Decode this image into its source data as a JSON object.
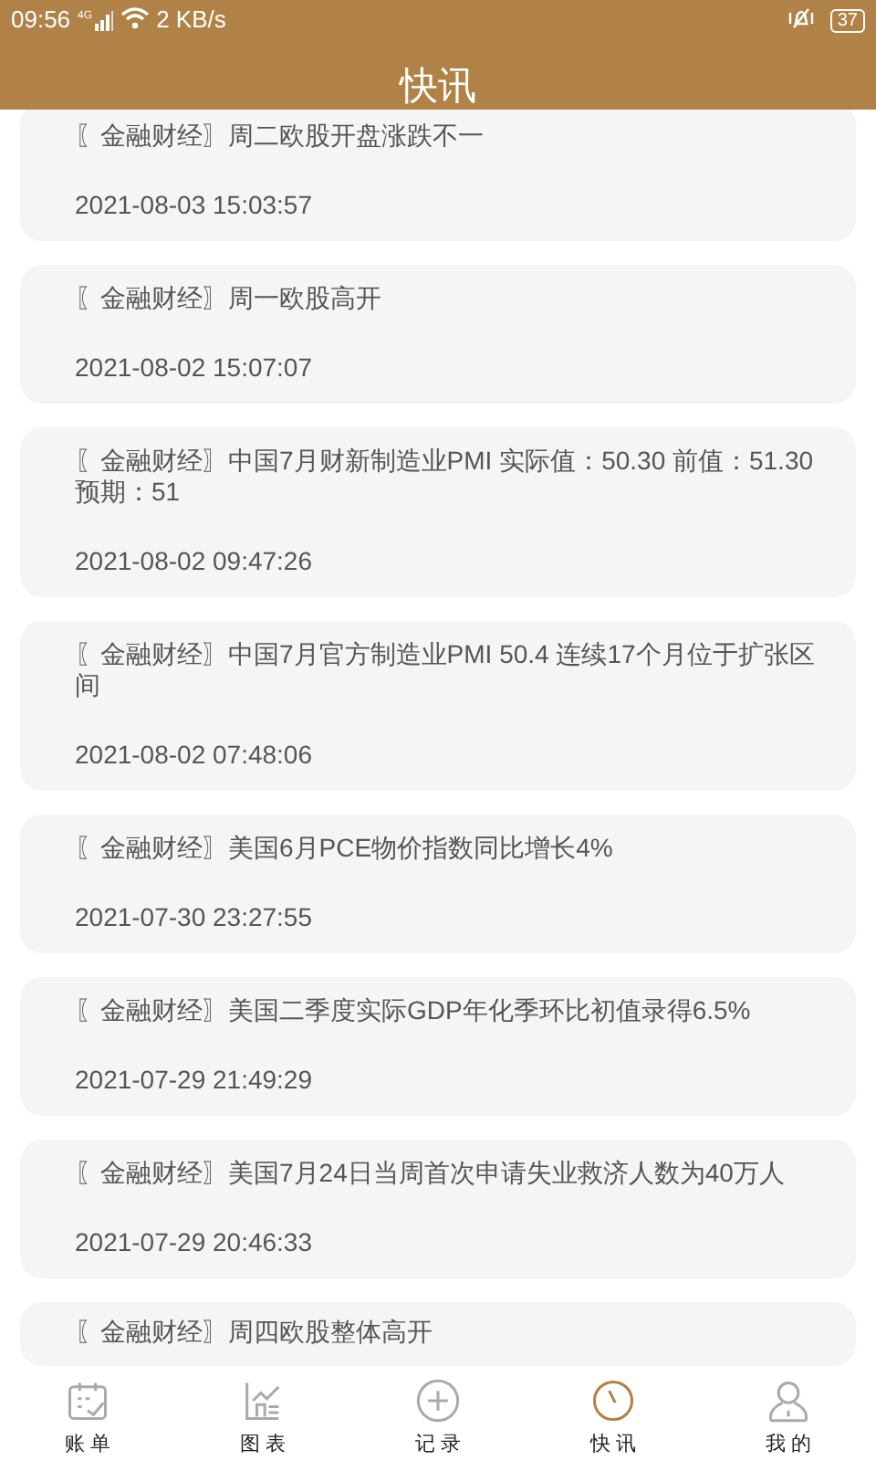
{
  "status_bar": {
    "time": "09:56",
    "network": "4G",
    "speed": "2 KB/s",
    "battery": "37"
  },
  "header": {
    "title": "快讯"
  },
  "news": [
    {
      "title": "〖金融财经〗周二欧股开盘涨跌不一",
      "time": "2021-08-03 15:03:57"
    },
    {
      "title": "〖金融财经〗周一欧股高开",
      "time": "2021-08-02 15:07:07"
    },
    {
      "title": "〖金融财经〗中国7月财新制造业PMI 实际值：50.30  前值：51.30   预期：51",
      "time": "2021-08-02 09:47:26"
    },
    {
      "title": "〖金融财经〗中国7月官方制造业PMI 50.4 连续17个月位于扩张区间",
      "time": "2021-08-02 07:48:06"
    },
    {
      "title": "〖金融财经〗美国6月PCE物价指数同比增长4%",
      "time": "2021-07-30 23:27:55"
    },
    {
      "title": "〖金融财经〗美国二季度实际GDP年化季环比初值录得6.5%",
      "time": "2021-07-29 21:49:29"
    },
    {
      "title": "〖金融财经〗美国7月24日当周首次申请失业救济人数为40万人",
      "time": "2021-07-29 20:46:33"
    },
    {
      "title": "〖金融财经〗周四欧股整体高开"
    }
  ],
  "tab_bar": [
    {
      "kind": "bill",
      "label": "账单",
      "selected": false
    },
    {
      "kind": "chart",
      "label": "图表",
      "selected": false
    },
    {
      "kind": "add",
      "label": "记录",
      "selected": false
    },
    {
      "kind": "clock",
      "label": "快讯",
      "selected": true
    },
    {
      "kind": "user",
      "label": "我的",
      "selected": false
    }
  ]
}
